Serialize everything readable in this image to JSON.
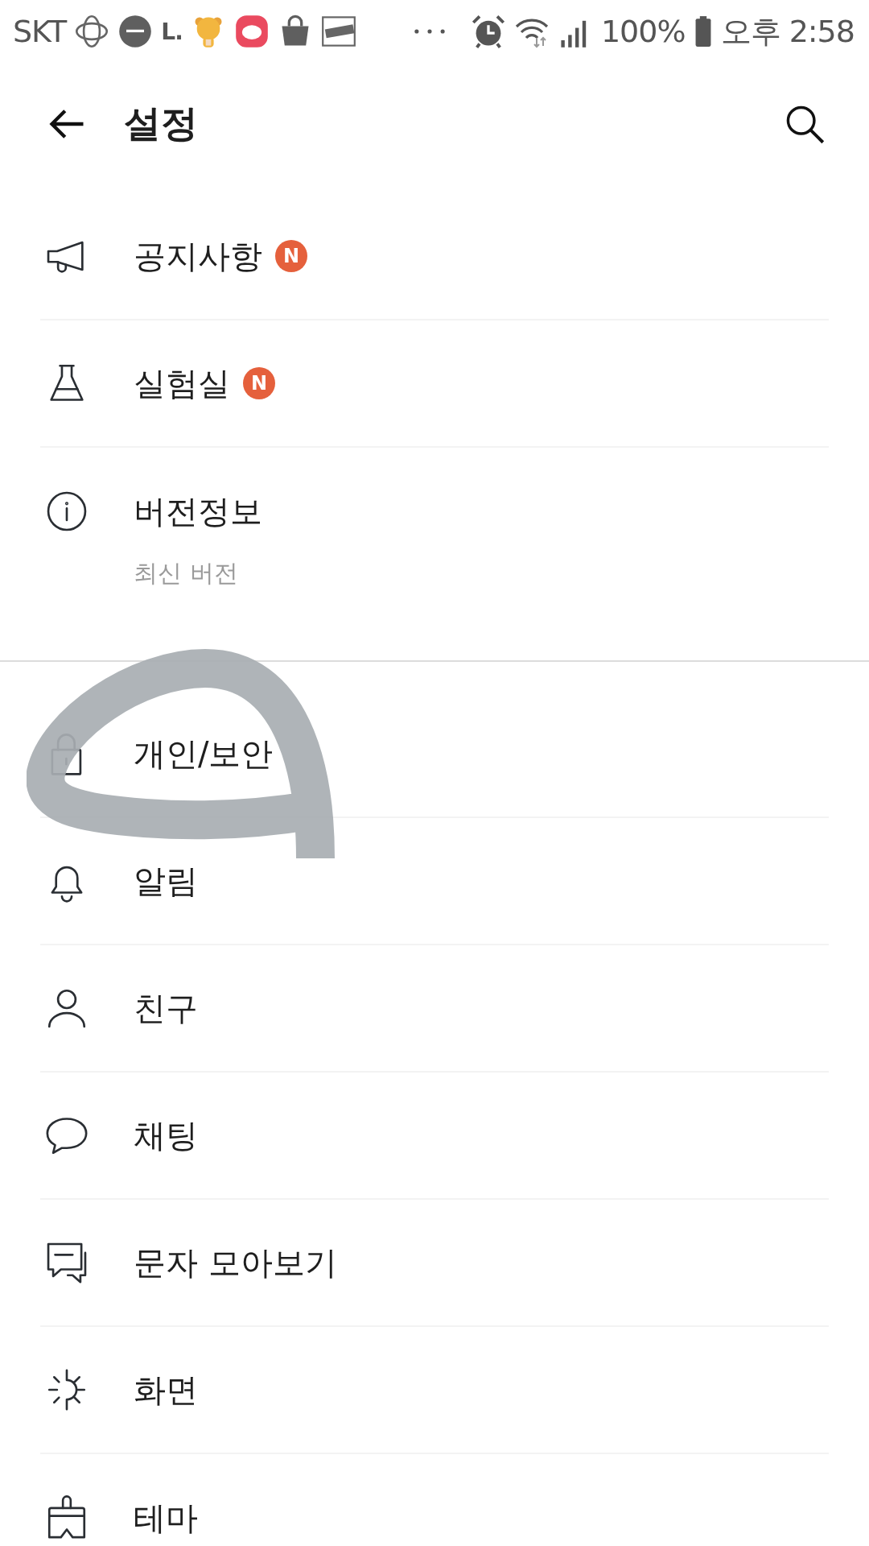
{
  "status_bar": {
    "carrier": "SKT",
    "app_label": "L.",
    "battery": "100%",
    "time": "오후 2:58"
  },
  "header": {
    "title": "설정"
  },
  "sections": [
    {
      "items": [
        {
          "label": "공지사항",
          "badge": "N"
        },
        {
          "label": "실험실",
          "badge": "N"
        },
        {
          "label": "버전정보",
          "subtitle": "최신 버전"
        }
      ]
    },
    {
      "items": [
        {
          "label": "개인/보안"
        },
        {
          "label": "알림"
        },
        {
          "label": "친구"
        },
        {
          "label": "채팅"
        },
        {
          "label": "문자 모아보기"
        },
        {
          "label": "화면"
        },
        {
          "label": "테마"
        }
      ]
    }
  ]
}
